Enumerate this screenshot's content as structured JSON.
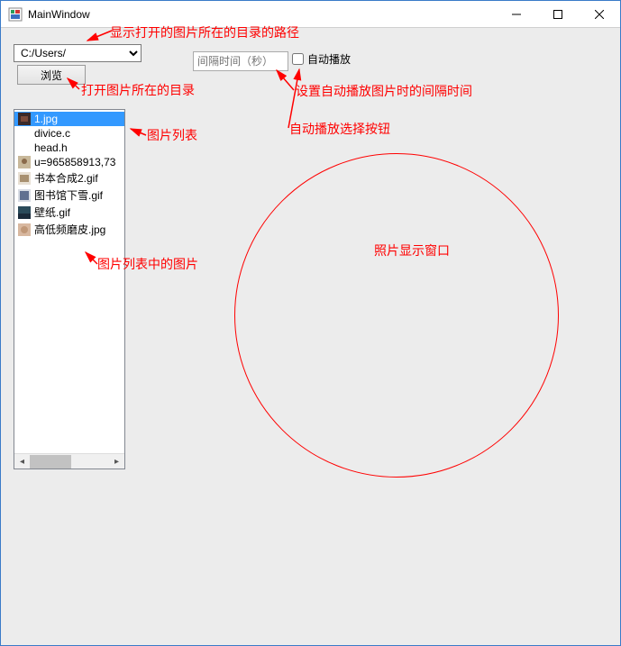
{
  "window": {
    "title": "MainWindow"
  },
  "toolbar": {
    "path_value": "C:/Users/",
    "browse_label": "浏览",
    "interval_placeholder": "间隔时间（秒）",
    "auto_play_label": "自动播放"
  },
  "file_list": {
    "items": [
      {
        "icon": "thumb-dark",
        "label": "1.jpg",
        "selected": true
      },
      {
        "icon": "none",
        "label": "divice.c"
      },
      {
        "icon": "none",
        "label": "head.h"
      },
      {
        "icon": "thumb-photo",
        "label": "u=965858913,73"
      },
      {
        "icon": "thumb-book",
        "label": "书本合成2.gif"
      },
      {
        "icon": "thumb-lib",
        "label": "图书馆下雪.gif"
      },
      {
        "icon": "thumb-wall",
        "label": "壁纸.gif"
      },
      {
        "icon": "thumb-skin",
        "label": "高低频磨皮.jpg"
      }
    ]
  },
  "annotations": {
    "a1": "显示打开的图片所在的目录的路径",
    "a2": "打开图片所在的目录",
    "a3": "图片列表",
    "a4": "图片列表中的图片",
    "a5": "设置自动播放图片时的间隔时间",
    "a6": "自动播放选择按钮",
    "a7": "照片显示窗口"
  }
}
